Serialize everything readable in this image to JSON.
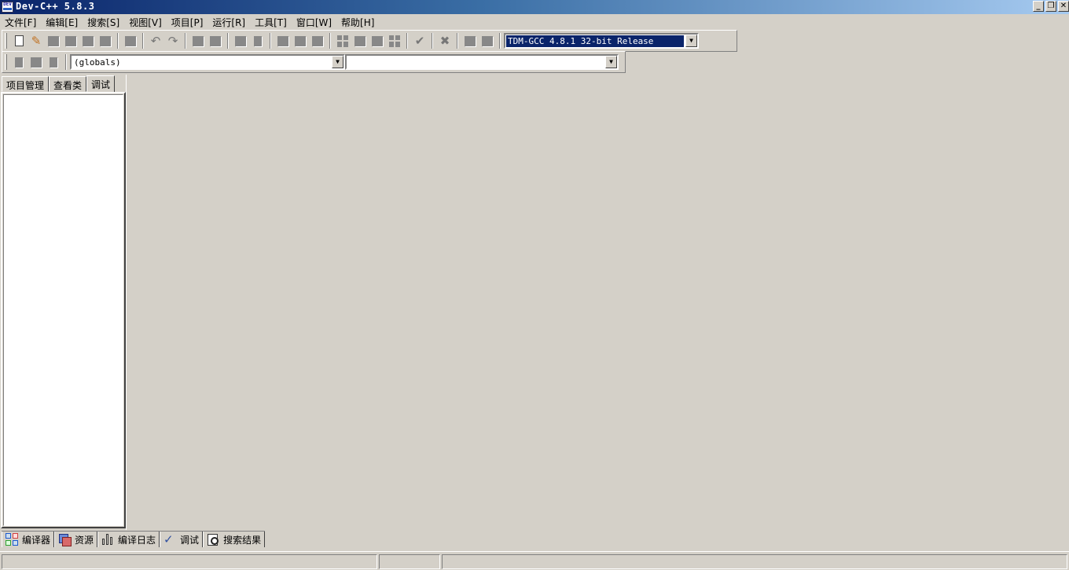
{
  "window": {
    "title": "Dev-C++ 5.8.3",
    "icon_text": "DEV",
    "minimize": "_",
    "restore": "❐",
    "close": "✕"
  },
  "menu": [
    "文件[F]",
    "编辑[E]",
    "搜索[S]",
    "视图[V]",
    "项目[P]",
    "运行[R]",
    "工具[T]",
    "窗口[W]",
    "帮助[H]"
  ],
  "toolbar": {
    "compiler": "TDM-GCC 4.8.1 32-bit Release",
    "icons": [
      "new-file-icon",
      "open-file-icon",
      "save-icon",
      "save-all-icon",
      "close-icon",
      "close-all-icon",
      "print-icon",
      "undo-icon",
      "redo-icon",
      "find-icon",
      "replace-icon",
      "goto-line-icon",
      "compile-icon",
      "run-icon",
      "compile-run-icon",
      "rebuild-icon",
      "debug-icon",
      "syntax-check-icon",
      "abort-icon",
      "profile-icon",
      "delete-profile-icon"
    ]
  },
  "class_bar": {
    "scope": "(globals)",
    "member": ""
  },
  "left_tabs": [
    "项目管理",
    "查看类",
    "调试"
  ],
  "bottom_tabs": [
    "编译器",
    "资源",
    "编译日志",
    "调试",
    "搜索结果"
  ],
  "status": [
    "",
    "",
    ""
  ]
}
